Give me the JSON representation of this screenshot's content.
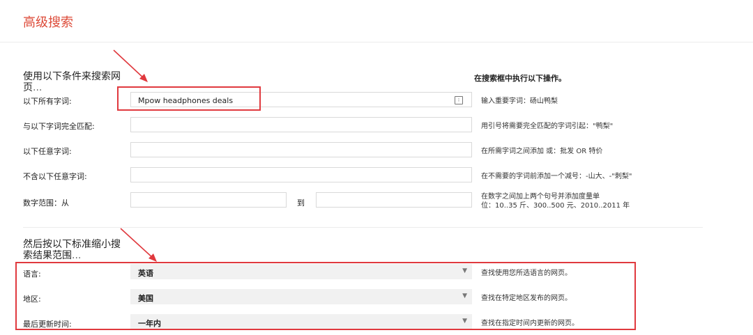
{
  "page": {
    "title": "高级搜索"
  },
  "section1": {
    "heading": "使用以下条件来搜索网页",
    "heading_ellipsis": "...",
    "help_heading": "在搜索框中执行以下操作。"
  },
  "fields": [
    {
      "label": "以下所有字词:",
      "value": "Mpow headphones deals",
      "help": "输入重要字词：砀山鸭梨"
    },
    {
      "label": "与以下字词完全匹配:",
      "value": "",
      "help": "用引号将需要完全匹配的字词引起：\"鸭梨\""
    },
    {
      "label": "以下任意字词:",
      "value": "",
      "help": "在所需字词之间添加 或：批发 OR 特价"
    },
    {
      "label": "不含以下任意字词:",
      "value": "",
      "help": "在不需要的字词前添加一个减号：-山大、-\"刺梨\""
    },
    {
      "label": "数字范围：从",
      "to_label": "到",
      "from_value": "",
      "to_value": "",
      "help_line1": "在数字之间加上两个句号并添加度量单",
      "help_line2": "位：10..35 斤、300..500 元、2010..2011 年"
    }
  ],
  "section2": {
    "heading": "然后按以下标准缩小搜索结果范围",
    "heading_ellipsis": "..."
  },
  "filters": [
    {
      "label": "语言:",
      "selected": "英语",
      "help": "查找使用您所选语言的网页。"
    },
    {
      "label": "地区:",
      "selected": "美国",
      "help": "查找在特定地区发布的网页。"
    },
    {
      "label": "最后更新时间:",
      "selected": "一年内",
      "help": "查找在指定时间内更新的网页。"
    }
  ],
  "icons": {
    "keyboard": "keyboard-icon",
    "dropdown": "chevron-down-icon",
    "annotation_arrow": "red-arrow-icon"
  },
  "colors": {
    "title": "#dd4b39",
    "annotation": "#e0393e"
  }
}
